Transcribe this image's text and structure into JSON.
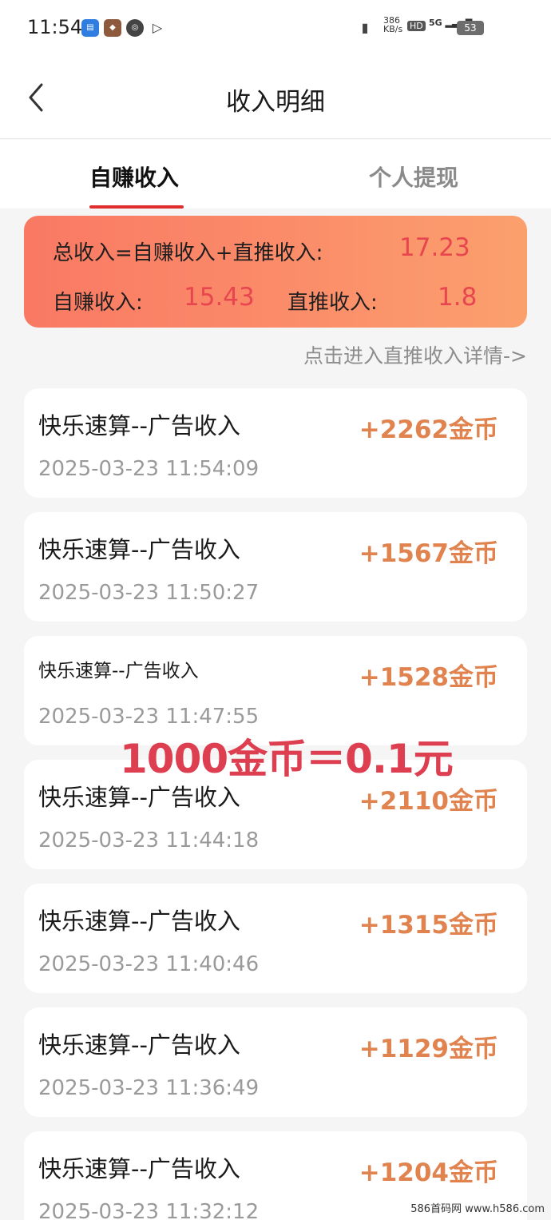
{
  "status_bar": {
    "time": "11:54",
    "network_speed": "386",
    "network_unit": "KB/s",
    "hd": "HD",
    "signal": "5G",
    "battery": "53"
  },
  "header": {
    "title": "收入明细"
  },
  "tabs": [
    {
      "label": "自赚收入",
      "active": true
    },
    {
      "label": "个人提现",
      "active": false
    }
  ],
  "summary": {
    "total_label": "总收入=自赚收入+直推收入:",
    "total_value": "17.23",
    "self_label": "自赚收入:",
    "self_value": "15.43",
    "direct_label": "直推收入:",
    "direct_value": "1.8",
    "detail_link": "点击进入直推收入详情->"
  },
  "records": [
    {
      "title": "快乐速算--广告收入",
      "amount": "+2262金币",
      "time": "2025-03-23 11:54:09"
    },
    {
      "title": "快乐速算--广告收入",
      "amount": "+1567金币",
      "time": "2025-03-23 11:50:27"
    },
    {
      "title": "快乐速算--广告收入",
      "amount": "+1528金币",
      "time": "2025-03-23 11:47:55"
    },
    {
      "title": "快乐速算--广告收入",
      "amount": "+2110金币",
      "time": "2025-03-23 11:44:18"
    },
    {
      "title": "快乐速算--广告收入",
      "amount": "+1315金币",
      "time": "2025-03-23 11:40:46"
    },
    {
      "title": "快乐速算--广告收入",
      "amount": "+1129金币",
      "time": "2025-03-23 11:36:49"
    },
    {
      "title": "快乐速算--广告收入",
      "amount": "+1204金币",
      "time": "2025-03-23 11:32:12"
    }
  ],
  "overlay_text": "1000金币＝0.1元",
  "watermark": "586首码网 www.h586.com",
  "colors": {
    "accent_red": "#e02e2e",
    "amount_orange": "#e0834f",
    "summary_value": "#e8464e"
  }
}
